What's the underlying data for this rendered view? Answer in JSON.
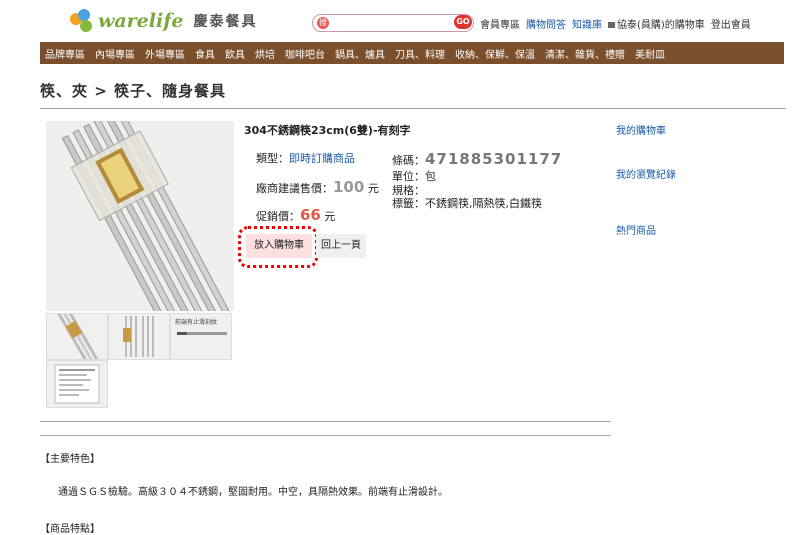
{
  "header": {
    "logo_text": "warelife",
    "logo_cn": "慶泰餐具",
    "search_icon_text": "搜",
    "go_label": "GO",
    "links": [
      "會員專區",
      "購物問答",
      "知識庫",
      "協泰(員購)的購物車",
      "登出會員"
    ]
  },
  "nav": {
    "items": [
      "品牌專區",
      "內場專區",
      "外場專區",
      "食具",
      "飲具",
      "烘培",
      "咖啡吧台",
      "鍋具、爐具",
      "刀具、料理",
      "收納、保鮮、保溫",
      "清潔、雜貨、禮贈",
      "美耐皿"
    ]
  },
  "breadcrumb": "筷、夾 > 筷子、隨身餐具",
  "product": {
    "title": "304不銹鋼筷23cm(6雙)-有刻字",
    "type_label": "類型：",
    "type_value": "即時訂購商品",
    "msrp_label": "廠商建議售價：",
    "msrp_value": "100",
    "msrp_unit": "元",
    "promo_label": "促銷價：",
    "promo_value": "66",
    "promo_unit": "元",
    "barcode_label": "條碼：",
    "barcode_value": "471885301177",
    "unit_label": "單位：",
    "unit_value": "包",
    "spec_label": "規格：",
    "tag_label": "標籤：",
    "tag_value": "不銹鋼筷,隔熱筷,白鐵筷",
    "package_text": "前端有止滑刻紋"
  },
  "buttons": {
    "add_cart": "放入購物車",
    "back": "回上一頁"
  },
  "sidebar": {
    "cart": "我的購物車",
    "history": "我的瀏覽紀錄",
    "hot": "熱門商品"
  },
  "sections": {
    "features_title": "【主要特色】",
    "features_text": "通過ＳＧＳ檢驗。高級３０４不銹鋼，堅固耐用。中空，具隔熱效果。前端有止滑設計。",
    "points_title": "【商品特點】"
  },
  "colors": {
    "nav_bg": "#7a4f2d",
    "link_blue": "#1b5aa8",
    "promo_red": "#e05a46",
    "highlight_ring": "#e00000"
  }
}
